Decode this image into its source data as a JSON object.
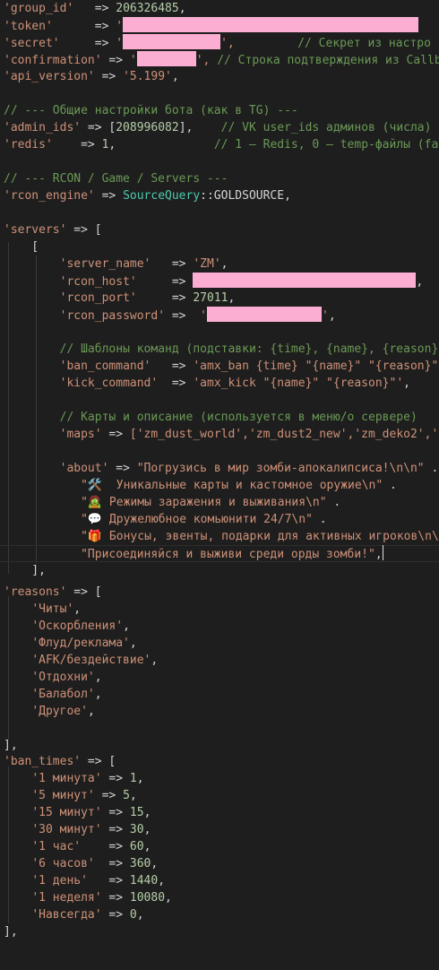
{
  "config": {
    "group_id": {
      "key": "'group_id'",
      "arrow": "   =>",
      "value": "206326485"
    },
    "token": {
      "key": "'token'",
      "arrow": "      =>",
      "value": "'"
    },
    "secret": {
      "key": "'secret'",
      "arrow": "     =>",
      "open": "'",
      "close": "',",
      "comment": "// Секрет из настро"
    },
    "confirmation": {
      "key": "'confirmation'",
      "arrow": "=>",
      "open": "'",
      "close": "',",
      "comment": "// Строка подтверждения из Callba"
    },
    "api_version": {
      "key": "'api_version'",
      "arrow": " =>",
      "value": "'5.199'"
    }
  },
  "general": {
    "heading": "// --- Общие настройки бота (как в TG) ---",
    "admin_ids": {
      "key": "'admin_ids'",
      "arrow": "=>",
      "value": "208996082",
      "comment": "// VK user_ids админов (числа)"
    },
    "redis": {
      "key": "'redis'",
      "arrow": "    =>",
      "value": "1",
      "comment": "// 1 — Redis, 0 — temp-файлы (fal"
    }
  },
  "rcon": {
    "heading": "// --- RCON / Game / Servers ---",
    "engine": {
      "key": "'rcon_engine'",
      "arrow": "=>",
      "class": "SourceQuery",
      "const": "::GOLDSOURCE,"
    }
  },
  "servers": {
    "key": "'servers'",
    "arrow": "=> [",
    "server_name": {
      "key": "'server_name'",
      "arrow": "   =>",
      "value": "'ZM'"
    },
    "rcon_host": {
      "key": "'rcon_host'",
      "arrow": "     =>"
    },
    "rcon_port": {
      "key": "'rcon_port'",
      "arrow": "     =>",
      "value": "27011"
    },
    "rcon_password": {
      "key": "'rcon_password'",
      "arrow": " =>",
      "open": "'"
    },
    "templates_comment": "// Шаблоны команд (подставки: {time}, {name}, {reason})",
    "ban_command": {
      "key": "'ban_command'",
      "arrow": "   =>",
      "value": "'amx_ban {time} \"{name}\" \"{reason}\""
    },
    "kick_command": {
      "key": "'kick_command'",
      "arrow": "  =>",
      "value": "'amx_kick \"{name}\" \"{reason}\"'"
    },
    "maps_comment": "// Карты и описание (используется в меню/о сервере)",
    "maps": {
      "key": "'maps'",
      "arrow": "=>",
      "value": "['zm_dust_world','zm_dust2_new','zm_deko2','z"
    },
    "about": {
      "key": "'about'",
      "arrow": "=>",
      "line1": "\"Погрузись в мир зомби-апокалипсиса!\\n\\n\"",
      "line2": "\"🛠️  Уникальные карты и кастомное оружие\\n\"",
      "line3": "\"🧟 Режимы заражения и выживания\\n\"",
      "line4": "\"💬 Дружелюбное комьюнити 24/7\\n\"",
      "line5": "\"🎁 Бонусы, эвенты, подарки для активных игроков\\n\\",
      "line6": "\"Присоединяйся и выживи среди орды зомби!\""
    }
  },
  "reasons": {
    "key": "'reasons'",
    "arrow": "=> [",
    "items": [
      "'Читы'",
      "'Оскорбления'",
      "'Флуд/реклама'",
      "'AFK/бездействие'",
      "'Отдохни'",
      "'Балабол'",
      "'Другое'"
    ]
  },
  "ban_times": {
    "key": "'ban_times'",
    "arrow": "=> [",
    "items": [
      {
        "label": "'1 минута'",
        "arrow": "=>",
        "value": "1"
      },
      {
        "label": "'5 минут'",
        "arrow": " =>",
        "value": "5"
      },
      {
        "label": "'15 минут'",
        "arrow": "=>",
        "value": "15"
      },
      {
        "label": "'30 минут'",
        "arrow": "=>",
        "value": "30"
      },
      {
        "label": "'1 час'",
        "arrow": "    =>",
        "value": "60"
      },
      {
        "label": "'6 часов'",
        "arrow": "  =>",
        "value": "360"
      },
      {
        "label": "'1 день'",
        "arrow": "   =>",
        "value": "1440"
      },
      {
        "label": "'1 неделя'",
        "arrow": "=>",
        "value": "10080"
      },
      {
        "label": "'Навсегда'",
        "arrow": "=>",
        "value": "0"
      }
    ]
  },
  "colors": {
    "background": "#1e1e1e",
    "string": "#ce9178",
    "number": "#b5cea8",
    "comment": "#6a9955",
    "class": "#4ec9b0",
    "redacted": "#fbaed2"
  }
}
